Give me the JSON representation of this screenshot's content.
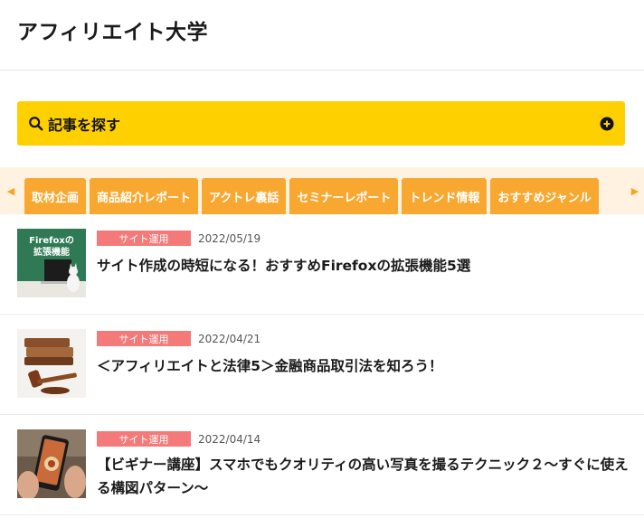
{
  "site": {
    "title": "アフィリエイト大学"
  },
  "search": {
    "label": "記事を探す"
  },
  "tabs": [
    {
      "label": "取材企画"
    },
    {
      "label": "商品紹介レポート"
    },
    {
      "label": "アクトレ裏話"
    },
    {
      "label": "セミナーレポート"
    },
    {
      "label": "トレンド情報"
    },
    {
      "label": "おすすめジャンル"
    }
  ],
  "articles": [
    {
      "category": "サイト運用",
      "date": "2022/05/19",
      "title": "サイト作成の時短になる！おすすめFirefoxの拡張機能5選",
      "thumb_text": [
        "Firefoxの",
        "拡張機能"
      ]
    },
    {
      "category": "サイト運用",
      "date": "2022/04/21",
      "title": "＜アフィリエイトと法律5＞金融商品取引法を知ろう！"
    },
    {
      "category": "サイト運用",
      "date": "2022/04/14",
      "title": "【ビギナー講座】スマホでもクオリティの高い写真を撮るテクニック２～すぐに使える構図パターン～"
    }
  ],
  "colors": {
    "search_bg": "#ffd000",
    "tab_bg": "#f8a830",
    "tabs_strip_bg": "#fff2e0",
    "category_bg": "#f47a7a"
  },
  "icons": [
    "search-icon",
    "plus-circle-icon",
    "chevron-left-icon",
    "chevron-right-icon"
  ]
}
